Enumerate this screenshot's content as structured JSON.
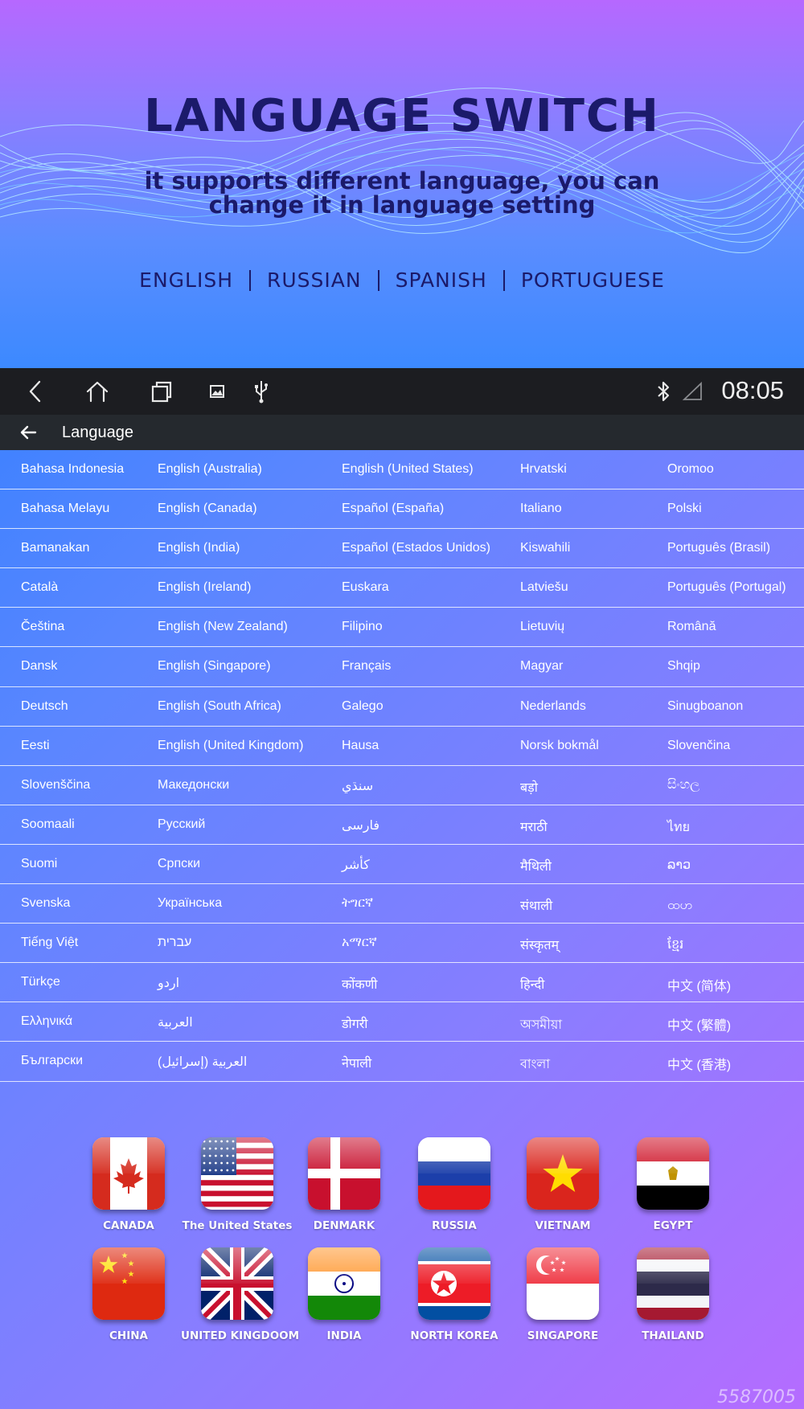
{
  "hero": {
    "title": "LANGUAGE SWITCH",
    "subtitle": "it supports different language, you can change it in language setting",
    "languages": [
      "ENGLISH",
      "RUSSIAN",
      "SPANISH",
      "PORTUGUESE"
    ]
  },
  "status_bar": {
    "icons": [
      "back-icon",
      "home-icon",
      "recent-apps-icon",
      "gallery-icon",
      "usb-icon",
      "bluetooth-icon",
      "signal-icon"
    ],
    "time": "08:05"
  },
  "app_bar": {
    "title": "Language"
  },
  "language_rows": [
    [
      "Bahasa Indonesia",
      "English (Australia)",
      "English (United States)",
      "Hrvatski",
      "Oromoo"
    ],
    [
      "Bahasa Melayu",
      "English (Canada)",
      "Español (España)",
      "Italiano",
      "Polski"
    ],
    [
      "Bamanakan",
      "English (India)",
      "Español (Estados Unidos)",
      "Kiswahili",
      "Português (Brasil)"
    ],
    [
      "Català",
      "English (Ireland)",
      "Euskara",
      "Latviešu",
      "Português (Portugal)"
    ],
    [
      "Čeština",
      "English (New Zealand)",
      "Filipino",
      "Lietuvių",
      "Română"
    ],
    [
      "Dansk",
      "English (Singapore)",
      "Français",
      "Magyar",
      "Shqip"
    ],
    [
      "Deutsch",
      "English (South Africa)",
      "Galego",
      "Nederlands",
      "Sinugboanon"
    ],
    [
      "Eesti",
      "English (United Kingdom)",
      "Hausa",
      "Norsk bokmål",
      "Slovenčina"
    ],
    [
      "Slovenščina",
      "Македонски",
      "سنڌي",
      "बड़ो",
      "සිංහල"
    ],
    [
      "Soomaali",
      "Русский",
      "فارسی",
      "मराठी",
      "ไทย"
    ],
    [
      "Suomi",
      "Српски",
      "کأشر",
      "मैथिली",
      "ລາວ"
    ],
    [
      "Svenska",
      "Українська",
      "ትግርኛ",
      "संथाली",
      "ထဟ"
    ],
    [
      "Tiếng Việt",
      "עברית",
      "አማርኛ",
      "संस्कृतम्",
      "ខ្មែរ"
    ],
    [
      "Türkçe",
      "اردو",
      "कोंकणी",
      "हिन्दी",
      "中文 (简体)"
    ],
    [
      "Ελληνικά",
      "العربية",
      "डोगरी",
      "অসমীয়া",
      "中文 (繁體)"
    ],
    [
      "Български",
      "العربية (إسرائيل)",
      "नेपाली",
      "বাংলা",
      "中文 (香港)"
    ]
  ],
  "flags": [
    {
      "label": "CANADA",
      "icon": "canada-flag-icon"
    },
    {
      "label": "The United States",
      "icon": "usa-flag-icon"
    },
    {
      "label": "DENMARK",
      "icon": "denmark-flag-icon"
    },
    {
      "label": "RUSSIA",
      "icon": "russia-flag-icon"
    },
    {
      "label": "VIETNAM",
      "icon": "vietnam-flag-icon"
    },
    {
      "label": "EGYPT",
      "icon": "egypt-flag-icon"
    },
    {
      "label": "CHINA",
      "icon": "china-flag-icon"
    },
    {
      "label": "UNITED KINGDOOM",
      "icon": "uk-flag-icon"
    },
    {
      "label": "INDIA",
      "icon": "india-flag-icon"
    },
    {
      "label": "NORTH KOREA",
      "icon": "north-korea-flag-icon"
    },
    {
      "label": "SINGAPORE",
      "icon": "singapore-flag-icon"
    },
    {
      "label": "THAILAND",
      "icon": "thailand-flag-icon"
    }
  ],
  "watermark": "5587005"
}
